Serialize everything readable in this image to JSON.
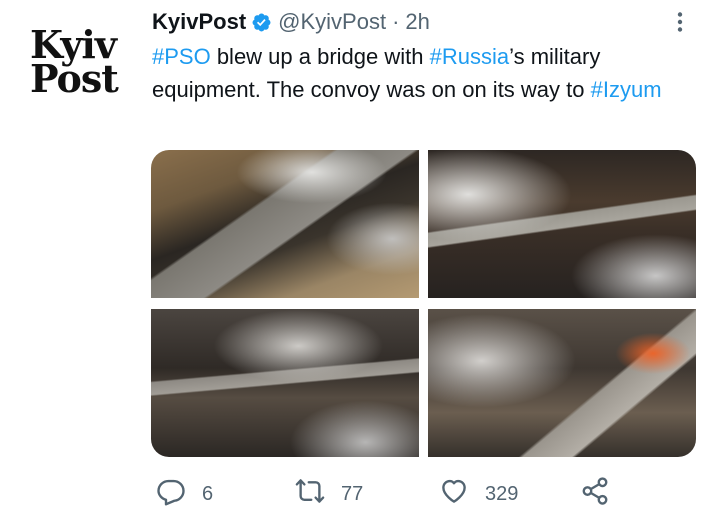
{
  "account": {
    "logo_line1": "Kyiv",
    "logo_line2": "Post",
    "name": "KyivPost",
    "handle": "@KyivPost",
    "separator": "·",
    "time": "2h"
  },
  "tweet": {
    "hashtag1": "#PSO",
    "text1": " blew up a bridge with ",
    "hashtag2": "#Russia",
    "text2": "’s military equipment. The convoy was on on its way to ",
    "hashtag3": "#Izyum"
  },
  "actions": {
    "reply_count": "6",
    "retweet_count": "77",
    "like_count": "329"
  },
  "icons": {
    "verified": "verified-badge-icon",
    "more": "more-options-icon",
    "reply": "reply-icon",
    "retweet": "retweet-icon",
    "like": "heart-icon",
    "share": "share-icon"
  },
  "colors": {
    "accent": "#1d9bf0",
    "secondary_text": "#536471",
    "primary_text": "#0f1419"
  }
}
